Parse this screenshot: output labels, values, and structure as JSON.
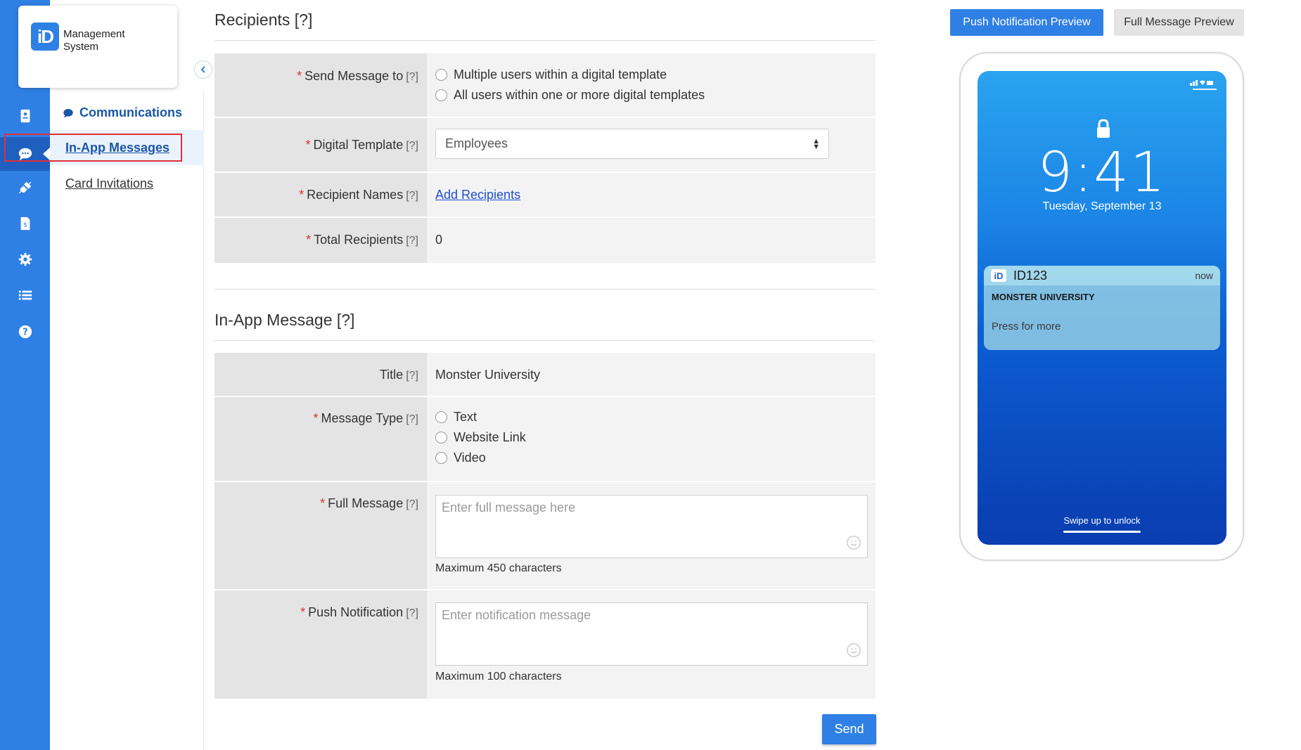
{
  "app": {
    "logo_mark": "iD",
    "logo_line1": "Management",
    "logo_line2": "System"
  },
  "rail": {
    "items": [
      {
        "icon": "id-card-icon"
      },
      {
        "icon": "chat-bubble-icon",
        "active": true
      },
      {
        "icon": "plug-icon"
      },
      {
        "icon": "invoice-icon"
      },
      {
        "icon": "gear-icon"
      },
      {
        "icon": "list-icon"
      },
      {
        "icon": "help-icon"
      }
    ]
  },
  "subnav": {
    "heading": "Communications",
    "items": [
      {
        "label": "In-App Messages",
        "active": true
      },
      {
        "label": "Card Invitations"
      }
    ]
  },
  "recipients": {
    "title": "Recipients",
    "help": "[?]",
    "send_to": {
      "label": "Send Message to",
      "options": [
        "Multiple users within a digital template",
        "All users within one or more digital templates"
      ]
    },
    "template": {
      "label": "Digital Template",
      "value": "Employees"
    },
    "names": {
      "label": "Recipient Names",
      "link": "Add Recipients"
    },
    "total": {
      "label": "Total Recipients",
      "value": "0"
    }
  },
  "message": {
    "title": "In-App Message",
    "help": "[?]",
    "title_field": {
      "label": "Title",
      "value": "Monster University"
    },
    "type": {
      "label": "Message Type",
      "options": [
        "Text",
        "Website Link",
        "Video"
      ]
    },
    "full": {
      "label": "Full Message",
      "placeholder": "Enter full message here",
      "hint": "Maximum 450 characters"
    },
    "push": {
      "label": "Push Notification",
      "placeholder": "Enter notification message",
      "hint": "Maximum 100 characters"
    },
    "send_label": "Send"
  },
  "preview": {
    "tabs": {
      "push": "Push Notification Preview",
      "full": "Full Message Preview"
    },
    "active_tab": "push",
    "time": "9:41",
    "date": "Tuesday, September 13",
    "notification": {
      "logo": "iD",
      "app": "ID123",
      "time": "now",
      "title": "MONSTER UNIVERSITY",
      "body": "Press for more"
    },
    "swipe": "Swipe up to unlock"
  },
  "colors": {
    "primary": "#2f80e4",
    "rail_active": "#1f5fc0",
    "highlight": "#e0303b",
    "required": "#d9352b",
    "link": "#1d4fd0"
  }
}
